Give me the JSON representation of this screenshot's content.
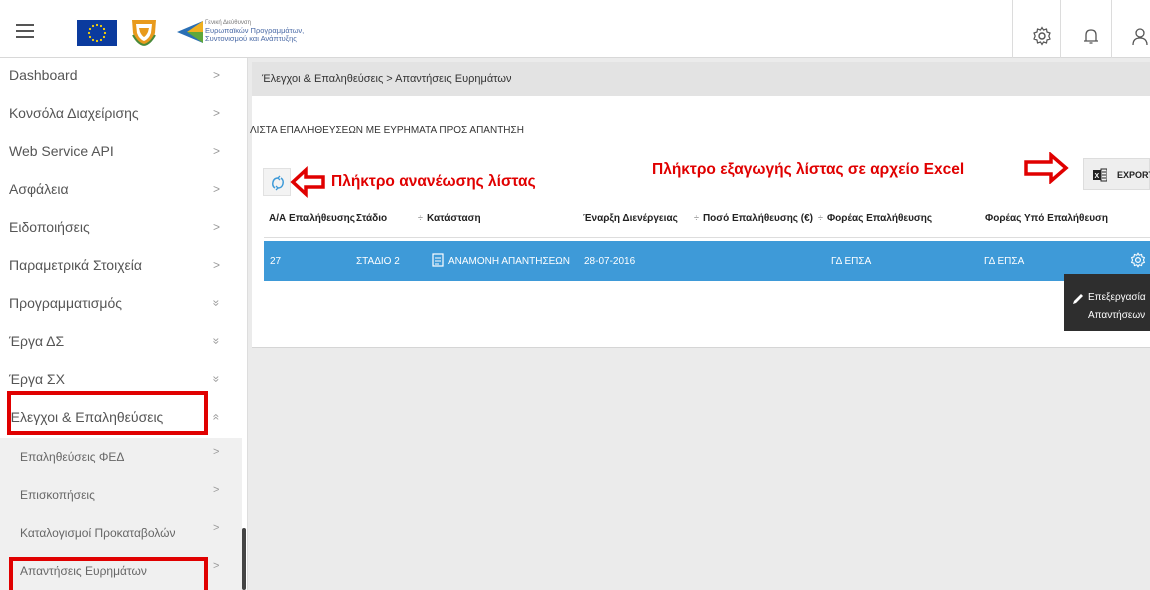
{
  "header": {
    "org_lines": [
      "Γενική Διεύθυνση",
      "Ευρωπαϊκών Προγραμμάτων,",
      "Συντονισμού και Ανάπτυξης"
    ]
  },
  "sidebar": {
    "items": [
      {
        "label": "Dashboard",
        "arrow": ">"
      },
      {
        "label": "Κονσόλα Διαχείρισης",
        "arrow": ">"
      },
      {
        "label": "Web Service API",
        "arrow": ">"
      },
      {
        "label": "Ασφάλεια",
        "arrow": ">"
      },
      {
        "label": "Ειδοποιήσεις",
        "arrow": ">"
      },
      {
        "label": "Παραμετρικά Στοιχεία",
        "arrow": ">"
      },
      {
        "label": "Προγραμματισμός",
        "arrow": "»"
      },
      {
        "label": "Έργα ΔΣ",
        "arrow": "»"
      },
      {
        "label": "Έργα ΣΧ",
        "arrow": "»"
      },
      {
        "label": "Έλεγχοι & Επαληθεύσεις",
        "arrow": "«"
      }
    ],
    "subitems": [
      {
        "label": "Επαληθεύσεις ΦΕΔ",
        "arrow": ">"
      },
      {
        "label": "Επισκοπήσεις",
        "arrow": ">"
      },
      {
        "label": "Καταλογισμοί Προκαταβολών",
        "arrow": ">"
      },
      {
        "label": "Απαντήσεις Ευρημάτων",
        "arrow": ">"
      }
    ]
  },
  "breadcrumb": "Έλεγχοι & Επαληθεύσεις  >  Απαντήσεις Ευρημάτων",
  "page_title": "ΛΙΣΤΑ ΕΠΑΛΗΘΕΥΣΕΩΝ ΜΕ ΕΥΡΗΜΑΤΑ ΠΡΟΣ ΑΠΑΝΤΗΣΗ",
  "annotations": {
    "refresh": "Πλήκτρο ανανέωσης λίστας",
    "export": "Πλήκτρο εξαγωγής λίστας σε αρχείο Excel"
  },
  "export_label": "EXPORT",
  "table": {
    "headers": [
      "Α/Α Επαλήθευσης",
      "Στάδιο",
      "Κατάσταση",
      "Έναρξη Διενέργειας",
      "Ποσό Επαλήθευσης (€)",
      "Φορέας Επαλήθευσης",
      "Φορέας Υπό Επαλήθευση"
    ],
    "rows": [
      {
        "id": "27",
        "stage": "ΣΤΑΔΙΟ 2",
        "status": "ΑΝΑΜΟΝΗ ΑΠΑΝΤΗΣΕΩΝ",
        "start": "28-07-2016",
        "amount": "",
        "verifier": "ΓΔ ΕΠΣΑ",
        "verified": "ΓΔ ΕΠΣΑ"
      }
    ]
  },
  "tooltip": {
    "line1": "Επεξεργασία",
    "line2": "Απαντήσεων"
  },
  "colors": {
    "accent": "#3e9ad8",
    "highlight": "#e00000"
  }
}
